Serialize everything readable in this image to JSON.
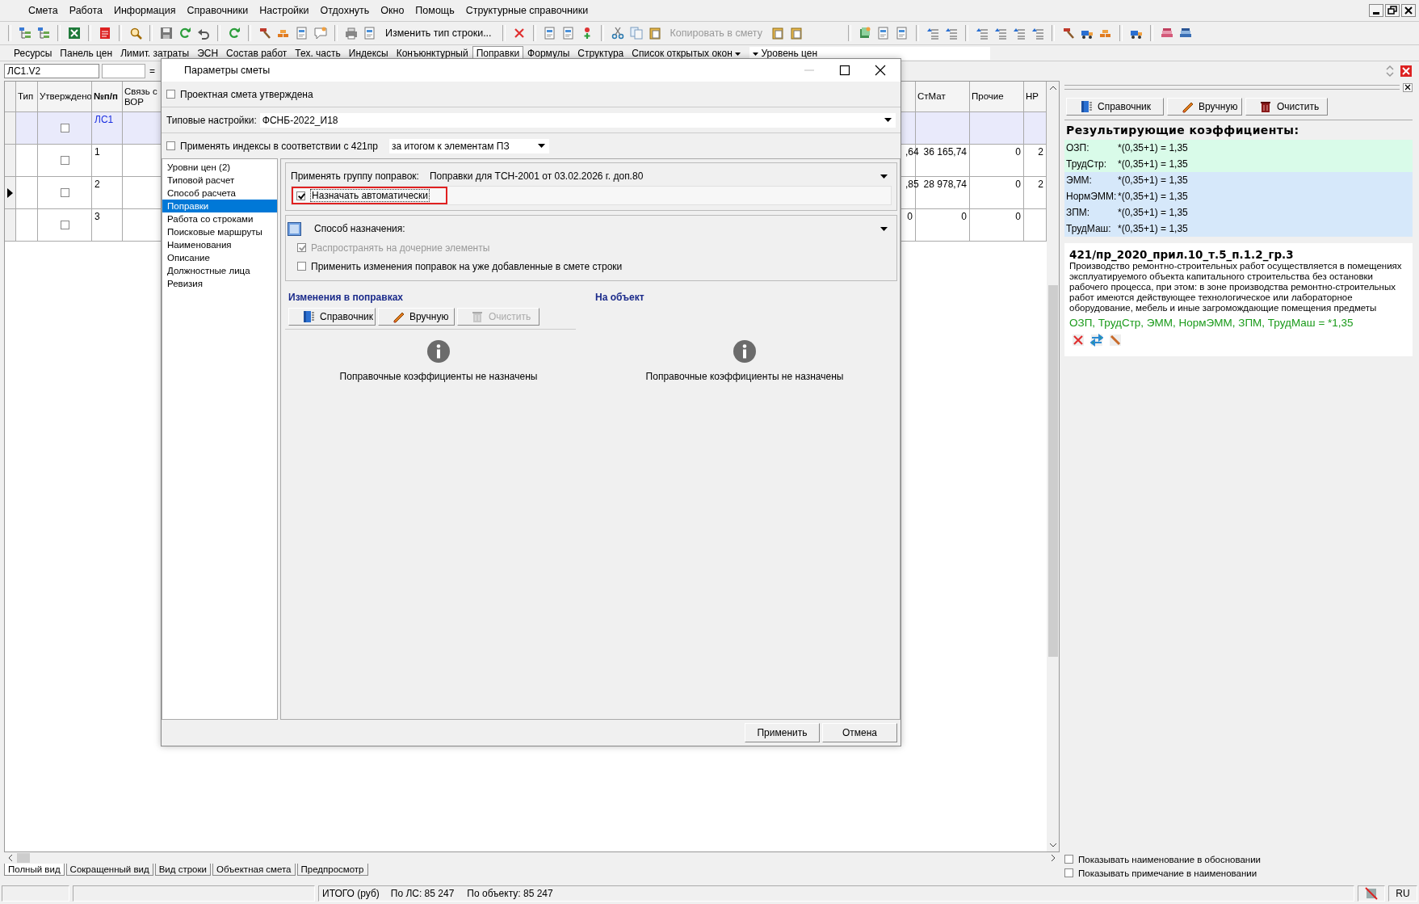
{
  "menu": [
    "Смета",
    "Работа",
    "Информация",
    "Справочники",
    "Настройки",
    "Отдохнуть",
    "Окно",
    "Помощь",
    "Структурные справочники"
  ],
  "toolbar": {
    "change_type": {
      "label": "Изменить тип строки...",
      "disabled": false
    },
    "copy_to_estimate": {
      "label": "Копировать в смету",
      "disabled": true
    }
  },
  "panel_bar": {
    "items": [
      {
        "label": "Ресурсы",
        "selected": false
      },
      {
        "label": "Панель цен",
        "selected": false
      },
      {
        "label": "Лимит. затраты",
        "selected": false
      },
      {
        "label": "ЭСН",
        "selected": false
      },
      {
        "label": "Состав работ",
        "selected": false
      },
      {
        "label": "Тех. часть",
        "selected": false
      },
      {
        "label": "Индексы",
        "selected": false
      },
      {
        "label": "Конъюнктурный",
        "selected": false
      },
      {
        "label": "Поправки",
        "selected": true
      },
      {
        "label": "Формулы",
        "selected": false
      },
      {
        "label": "Структура",
        "selected": false
      }
    ],
    "open_windows": "Список открытых окон",
    "price_level": "Уровень цен"
  },
  "address_bar": {
    "value": "ЛС1.V2",
    "operator": "="
  },
  "grid": {
    "columns": [
      {
        "label": "Тип",
        "bold": false
      },
      {
        "label": "Утверждено",
        "bold": false
      },
      {
        "label": "№п/п",
        "bold": true
      },
      {
        "label": "Связь с ВОР",
        "bold": false
      }
    ],
    "right_columns": [
      "СтМат",
      "Прочие",
      "НР"
    ],
    "rows": [
      {
        "number": "ЛС1",
        "kind": "estimate",
        "approved": false,
        "current": false
      },
      {
        "number": "1",
        "kind": "item",
        "approved": false,
        "current": false,
        "values": [
          ",64",
          "36 165,74",
          "0",
          "2"
        ]
      },
      {
        "number": "2",
        "kind": "item",
        "approved": false,
        "current": true,
        "values": [
          ",85",
          "28 978,74",
          "0",
          "2"
        ]
      },
      {
        "number": "3",
        "kind": "item",
        "approved": false,
        "current": false,
        "values": [
          "0",
          "0",
          "0"
        ]
      }
    ]
  },
  "view_tabs": [
    {
      "label": "Полный вид",
      "selected": true
    },
    {
      "label": "Сокращенный вид",
      "selected": false
    },
    {
      "label": "Вид строки",
      "selected": false
    },
    {
      "label": "Объектная смета",
      "selected": false
    },
    {
      "label": "Предпросмотр",
      "selected": false
    }
  ],
  "status_bar": {
    "total": "ИТОГО (руб)",
    "by_estimate": "По ЛС: 85 247",
    "by_object": "По объекту: 85 247",
    "language": "RU"
  },
  "side_panel": {
    "buttons": [
      {
        "label": "Справочник",
        "kind": "book"
      },
      {
        "label": "Вручную",
        "kind": "pencil"
      },
      {
        "label": "Очистить",
        "kind": "trash"
      }
    ],
    "title": "Результирующие коэффициенты:",
    "coefficients": [
      {
        "name": "ОЗП:",
        "formula": "*(0,35+1) = 1,35",
        "color": "#d9fbe9"
      },
      {
        "name": "ТрудСтр:",
        "formula": "*(0,35+1) = 1,35",
        "color": "#d9fbe9"
      },
      {
        "name": "ЭММ:",
        "formula": "*(0,35+1) = 1,35",
        "color": "#d6e8fa"
      },
      {
        "name": "НормЭММ:",
        "formula": "*(0,35+1) = 1,35",
        "color": "#d6e8fa"
      },
      {
        "name": "ЗПМ:",
        "formula": "*(0,35+1) = 1,35",
        "color": "#d6e8fa"
      },
      {
        "name": "ТрудМаш:",
        "formula": "*(0,35+1) = 1,35",
        "color": "#d6e8fa"
      }
    ],
    "note": {
      "title": "421/пр_2020_прил.10_т.5_п.1.2_гр.3",
      "text": "Производство ремонтно-строительных работ осуществляется в помещениях эксплуатируемого объекта капитального строительства без остановки рабочего процесса, при этом: в зоне производства ремонтно-строительных работ имеются действующее технологическое или лабораторное оборудование, мебель и иные загромождающие помещения предметы",
      "formula": "ОЗП, ТрудСтр, ЭММ, НормЭММ, ЗПМ, ТрудМаш = *1,35"
    },
    "options": [
      {
        "label": "Показывать наименование в обосновании",
        "checked": false
      },
      {
        "label": "Показывать примечание в наименовании",
        "checked": false
      }
    ]
  },
  "dialog": {
    "title": "Параметры сметы",
    "approved": {
      "label": "Проектная смета утверждена",
      "checked": false
    },
    "typical_settings": {
      "label": "Типовые настройки:",
      "value": "ФСНБ-2022_И18"
    },
    "indices": {
      "label": "Применять индексы в соответствии с 421пр",
      "checked": false,
      "mode": "за итогом к элементам ПЗ"
    },
    "nav": [
      {
        "label": "Уровни цен (2)",
        "selected": false
      },
      {
        "label": "Типовой расчет",
        "selected": false
      },
      {
        "label": "Способ расчета",
        "selected": false
      },
      {
        "label": "Поправки",
        "selected": true
      },
      {
        "label": "Работа со строками",
        "selected": false
      },
      {
        "label": "Поисковые маршруты",
        "selected": false
      },
      {
        "label": "Наименования",
        "selected": false
      },
      {
        "label": "Описание",
        "selected": false
      },
      {
        "label": "Должностные лица",
        "selected": false
      },
      {
        "label": "Ревизия",
        "selected": false
      }
    ],
    "correction_group": {
      "label": "Применять группу поправок:",
      "value": "Поправки для ТСН-2001 от 03.02.2026 г. доп.80"
    },
    "auto_assign": {
      "label": "Назначать автоматически",
      "checked": true,
      "highlighted": true
    },
    "assign_method": {
      "label": "Способ назначения:"
    },
    "options": [
      {
        "label": "Распространять на дочерние элементы",
        "checked": true,
        "disabled": true
      },
      {
        "label": "Применить изменения поправок на уже добавленные в смете строки",
        "checked": false,
        "disabled": false
      }
    ],
    "changes": {
      "title": "Изменения в поправках",
      "buttons": [
        {
          "label": "Справочник",
          "kind": "book",
          "disabled": false
        },
        {
          "label": "Вручную",
          "kind": "pencil",
          "disabled": false
        },
        {
          "label": "Очистить",
          "kind": "trash",
          "disabled": true
        }
      ],
      "empty_text": "Поправочные коэффициенты не назначены"
    },
    "object": {
      "title": "На объект",
      "empty_text": "Поправочные коэффициенты не назначены"
    },
    "footer": [
      "Применить",
      "Отмена"
    ]
  }
}
